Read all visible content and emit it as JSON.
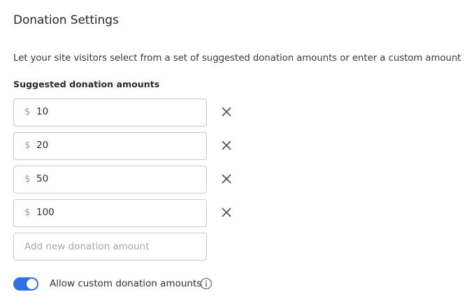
{
  "page": {
    "title": "Donation Settings",
    "description": "Let your site visitors select from a set of suggested donation amounts or enter a custom amount"
  },
  "suggested": {
    "label": "Suggested donation amounts",
    "currency_symbol": "$",
    "amounts": [
      {
        "value": "10",
        "remove_icon": "close-icon"
      },
      {
        "value": "20",
        "remove_icon": "close-icon"
      },
      {
        "value": "50",
        "remove_icon": "close-icon"
      },
      {
        "value": "100",
        "remove_icon": "close-icon"
      }
    ],
    "new_amount_placeholder": "Add new donation amount"
  },
  "custom": {
    "toggle_on": true,
    "label": "Allow custom donation amounts",
    "info_icon": "info-icon"
  },
  "colors": {
    "accent": "#2f6fe4",
    "border": "#c9c9c9",
    "placeholder": "#a8a8a8",
    "icon": "#555555"
  }
}
